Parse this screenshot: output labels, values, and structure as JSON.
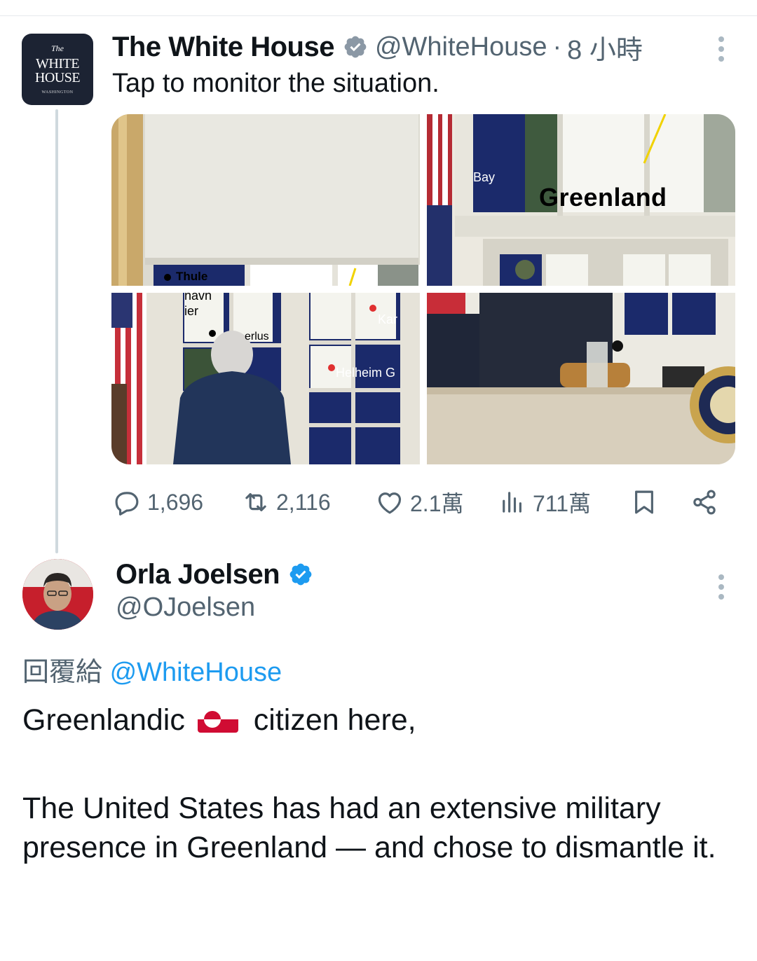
{
  "tweet1": {
    "avatar_lines": [
      "The",
      "WHITE",
      "HOUSE",
      "WASHINGTON"
    ],
    "name": "The White House",
    "handle": "@WhiteHouse",
    "separator": "·",
    "time": "8 小時",
    "text": "Tap to monitor the situation.",
    "media_labels": {
      "thule": "Thule",
      "bay": "Bay",
      "greenland": "Greenland",
      "navn": "navn",
      "ier": "ier",
      "erlus": "erlus",
      "kar": "Kar",
      "helheim": "Helheim G"
    },
    "actions": {
      "replies": "1,696",
      "reposts": "2,116",
      "likes": "2.1萬",
      "views": "711萬"
    }
  },
  "tweet2": {
    "name": "Orla Joelsen",
    "handle": "@OJoelsen",
    "reply_prefix": "回覆給",
    "reply_mention": "@WhiteHouse",
    "body_line1_a": "Greenlandic",
    "body_line1_b": "citizen here,",
    "body_para2": "The United States has had an extensive military presence in Greenland — and chose to dismantle it."
  },
  "colors": {
    "verified": "#1d9bf0",
    "muted": "#536471",
    "link": "#1d9bf0",
    "thread_line": "#cfd9de",
    "wh_avatar_bg": "#1c2333"
  }
}
